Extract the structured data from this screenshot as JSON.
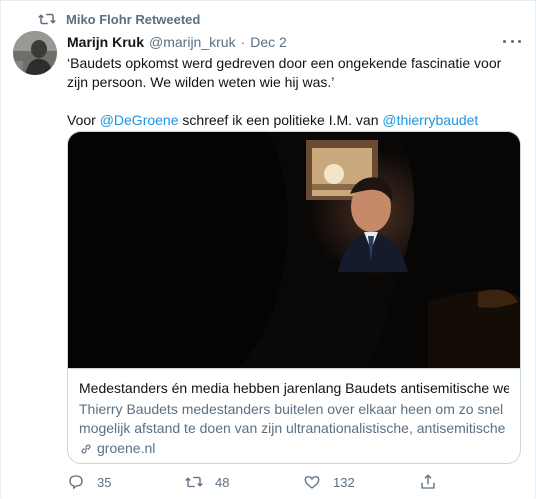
{
  "retweet": {
    "text": "Miko Flohr Retweeted",
    "icon": "retweet-icon"
  },
  "tweet": {
    "author_name": "Marijn Kruk",
    "author_handle": "@marijn_kruk",
    "separator": "·",
    "date": "Dec 2",
    "line1": "‘Baudets opkomst werd gedreven door een ongekende fascinatie voor zijn persoon. We wilden weten wie hij was.’",
    "line2_prefix": "Voor ",
    "mention1": "@DeGroene",
    "line2_middle": " schreef ik een politieke I.M. van ",
    "mention2": "@thierrybaudet"
  },
  "card": {
    "title": "Medestanders én media hebben jarenlang Baudets antisemitische wereld...",
    "description": "Thierry Baudets medestanders buitelen over elkaar heen om zo snel mogelijk afstand te doen van zijn ultranationalistische, antisemitische ...",
    "domain": "groene.nl"
  },
  "actions": {
    "replies": "35",
    "retweets": "48",
    "likes": "132"
  },
  "colors": {
    "link": "#1b95e0",
    "muted": "#5b7083",
    "text": "#0f1419",
    "border": "#ccd6dd"
  }
}
